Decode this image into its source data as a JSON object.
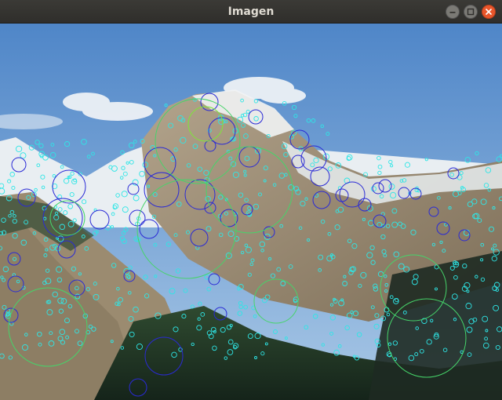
{
  "window": {
    "title": "Imagen",
    "controls": {
      "minimize_icon": "minimize-icon",
      "maximize_icon": "maximize-icon",
      "close_icon": "close-icon"
    }
  },
  "image": {
    "subject": "mountain-landscape-with-keypoint-overlay",
    "colors": {
      "sky_top": "#4f86c8",
      "sky_bottom": "#a9c8e6",
      "rock": "#9a8a72",
      "snow": "#eef2f5",
      "forest": "#1f3323",
      "keypoint_cyan": "#2ee6e6",
      "keypoint_blue": "#2a2ad6",
      "keypoint_green": "#46d46a",
      "keypoint_lime": "#7ee63a"
    }
  }
}
